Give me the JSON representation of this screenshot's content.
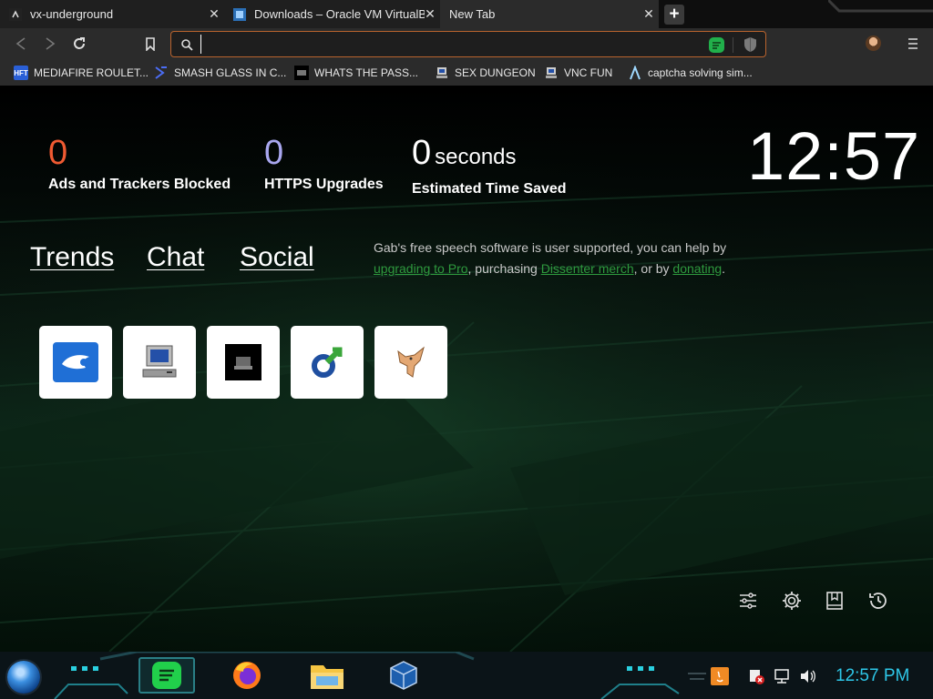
{
  "browser": {
    "tabs": [
      {
        "title": "vx-underground",
        "active": false
      },
      {
        "title": "Downloads – Oracle VM VirtualBox",
        "active": false
      },
      {
        "title": "New Tab",
        "active": true
      }
    ],
    "new_tab_icon": "plus-icon",
    "toolbar": {
      "back_icon": "back-arrow-icon",
      "forward_icon": "forward-arrow-icon",
      "reload_icon": "reload-icon",
      "bookmark_icon": "bookmark-icon",
      "address_value": "",
      "address_placeholder": "",
      "menu_icon": "hamburger-menu-icon"
    },
    "bookmarks": [
      {
        "label": "MEDIAFIRE ROULET...",
        "icon": "hft-icon",
        "icon_text": "HFT"
      },
      {
        "label": "SMASH GLASS IN C...",
        "icon": "chevron-glass-icon"
      },
      {
        "label": "WHATS THE PASS...",
        "icon": "terminal-icon"
      },
      {
        "label": "SEX DUNGEON",
        "icon": "computer-icon"
      },
      {
        "label": "VNC FUN",
        "icon": "computer-icon"
      },
      {
        "label": "captcha solving sim...",
        "icon": "lambda-icon"
      }
    ]
  },
  "newtab": {
    "stats": [
      {
        "value": "0",
        "unit": "",
        "label": "Ads and Trackers Blocked"
      },
      {
        "value": "0",
        "unit": "",
        "label": "HTTPS Upgrades"
      },
      {
        "value": "0",
        "unit": "seconds",
        "label": "Estimated Time Saved"
      }
    ],
    "clock": "12:57",
    "links": [
      "Trends",
      "Chat",
      "Social"
    ],
    "gab_message": {
      "before": "Gab's free speech software is user supported, you can help by ",
      "link1": "upgrading to Pro",
      "middle": ", purchasing ",
      "link2": "Dissenter merch",
      "after1": ", or by ",
      "link3": "donating",
      "after2": "."
    },
    "tiles": [
      "mediafire-icon",
      "computer-icon",
      "terminal-icon",
      "chain-link-icon",
      "cat-icon"
    ],
    "controls": [
      "sliders-icon",
      "gear-icon",
      "bookmarks-icon",
      "history-icon"
    ]
  },
  "taskbar": {
    "start_icon": "start-orb-icon",
    "apps": [
      "gab-dissenter-icon",
      "firefox-icon",
      "file-explorer-icon",
      "virtualbox-icon"
    ],
    "tray_icons": [
      "java-icon",
      "action-center-icon",
      "network-icon",
      "volume-icon"
    ],
    "time": "12:57 PM"
  },
  "colors": {
    "accent_orange": "#b8632e",
    "ads_counter": "#ef5a32",
    "https_counter": "#a9a7ef",
    "link_green": "#2e9a3e",
    "tray_time": "#2ec7e8"
  }
}
